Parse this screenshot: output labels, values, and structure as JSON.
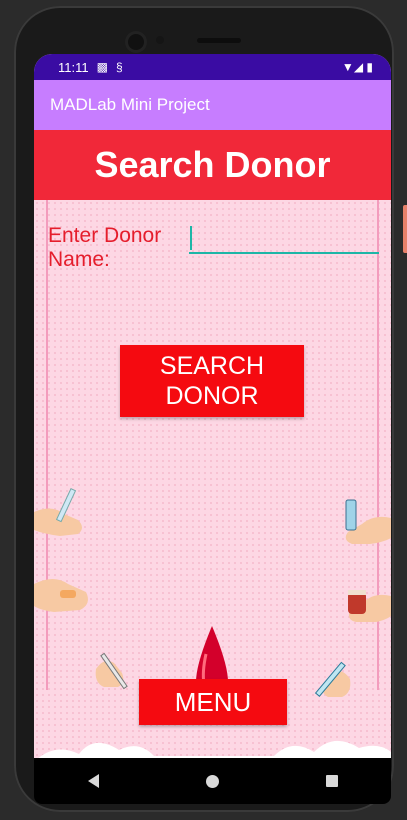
{
  "status_bar": {
    "time": "11:11",
    "left_icons": [
      "notification-icon",
      "sync-icon"
    ],
    "right_icons": [
      "wifi-icon",
      "signal-icon",
      "battery-icon"
    ]
  },
  "app_bar": {
    "title": "MADLab Mini Project"
  },
  "header": {
    "title": "Search Donor"
  },
  "form": {
    "label_line1": "Enter Donor",
    "label_line2": "Name:",
    "input_value": "",
    "input_placeholder": ""
  },
  "buttons": {
    "search_line1": "SEARCH",
    "search_line2": "DONOR",
    "menu": "MENU"
  },
  "colors": {
    "status_bar": "#3a0ca3",
    "app_bar": "#c77dff",
    "header": "#f12839",
    "button": "#f50a10",
    "label_text": "#e51d2c",
    "input_underline": "#1db6a7",
    "background": "#fdd7e4"
  }
}
